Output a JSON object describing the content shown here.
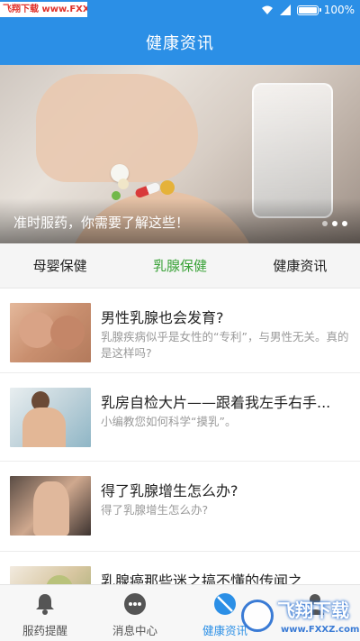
{
  "status_bar": {
    "watermark": "飞翔下载 www.FXXZ.com",
    "battery": "100%"
  },
  "header": {
    "title": "健康资讯"
  },
  "banner": {
    "caption": "准时服药，你需要了解这些！",
    "active_slide": 3,
    "slide_count": 3
  },
  "tabs": [
    {
      "label": "母婴保健",
      "active": false
    },
    {
      "label": "乳腺保健",
      "active": true
    },
    {
      "label": "健康资讯",
      "active": false
    }
  ],
  "articles": [
    {
      "title": "男性乳腺也会发育?",
      "desc": "乳腺疾病似乎是女性的“专利”，与男性无关。真的是这样吗?"
    },
    {
      "title": "乳房自检大片——跟着我左手右手...",
      "desc": "小编教您如何科学“摸乳”。"
    },
    {
      "title": "得了乳腺增生怎么办?",
      "desc": "得了乳腺增生怎么办?"
    },
    {
      "title": "乳腺癌那些迷之搞不懂的传闻之...",
      "desc": ""
    }
  ],
  "bottom_nav": [
    {
      "label": "服药提醒",
      "icon": "bell-icon",
      "active": false
    },
    {
      "label": "消息中心",
      "icon": "chat-icon",
      "active": false
    },
    {
      "label": "健康资讯",
      "icon": "no-entry-icon",
      "active": true
    },
    {
      "label": "",
      "icon": "person-icon",
      "active": false
    }
  ],
  "watermark_bottom": {
    "text": "飞翔下载",
    "url": "www.FXXZ.com"
  },
  "colors": {
    "primary": "#2b8fe6",
    "tab_active": "#3aa238",
    "desc_gray": "#9a9a9a"
  }
}
